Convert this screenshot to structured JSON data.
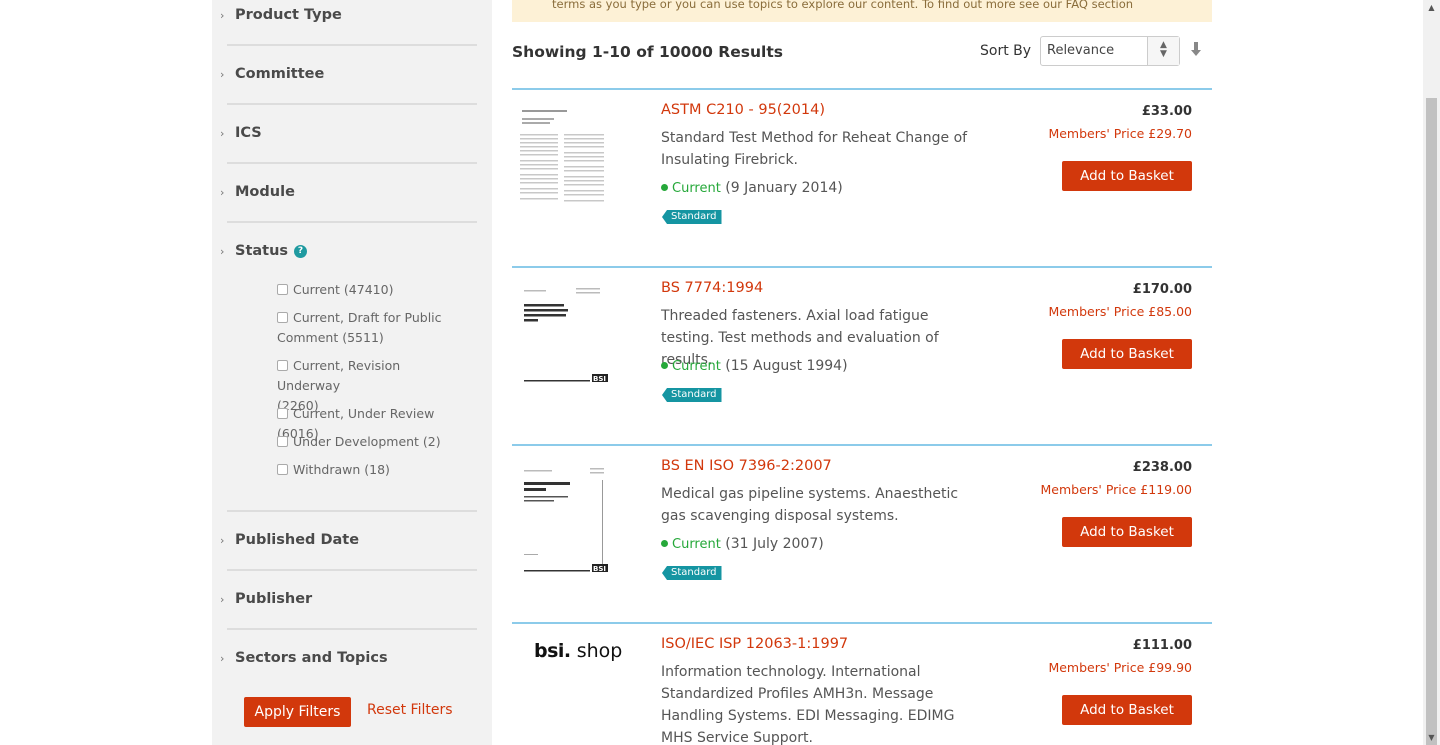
{
  "banner": {
    "text": "terms as you type or you can use topics to explore our content. To find out more see our FAQ section"
  },
  "sidebar": {
    "facets": {
      "product_type": "Product Type",
      "committee": "Committee",
      "ics": "ICS",
      "module": "Module",
      "status": "Status",
      "published_date": "Published Date",
      "publisher": "Publisher",
      "sectors": "Sectors and Topics"
    },
    "status_options": [
      {
        "line1": "Current (47410)",
        "line2": ""
      },
      {
        "line1": "Current, Draft for Public",
        "line2": "Comment (5511)"
      },
      {
        "line1": "Current, Revision Underway",
        "line2": "(2260)"
      },
      {
        "line1": "Current, Under Review (6016)",
        "line2": ""
      },
      {
        "line1": "Under Development (2)",
        "line2": ""
      },
      {
        "line1": "Withdrawn (18)",
        "line2": ""
      }
    ],
    "help_symbol": "?",
    "apply_label": "Apply Filters",
    "reset_label": "Reset Filters"
  },
  "toolbar": {
    "summary": "Showing 1-10 of 10000 Results",
    "sort_label": "Sort By",
    "sort_value": "Relevance"
  },
  "results": [
    {
      "title": "ASTM C210 - 95(2014)",
      "desc": "Standard Test Method for Reheat Change of Insulating Firebrick.",
      "status": "Current",
      "date": "(9 January 2014)",
      "badge": "Standard",
      "price": "£33.00",
      "member_price": "Members' Price £29.70",
      "button": "Add to Basket"
    },
    {
      "title": "BS 7774:1994",
      "desc": "Threaded fasteners. Axial load fatigue testing. Test methods and evaluation of results.",
      "status": "Current",
      "date": "(15 August 1994)",
      "badge": "Standard",
      "price": "£170.00",
      "member_price": "Members' Price £85.00",
      "button": "Add to Basket"
    },
    {
      "title": "BS EN ISO 7396-2:2007",
      "desc": "Medical gas pipeline systems. Anaesthetic gas scavenging disposal systems.",
      "status": "Current",
      "date": "(31 July 2007)",
      "badge": "Standard",
      "price": "£238.00",
      "member_price": "Members' Price £119.00",
      "button": "Add to Basket"
    },
    {
      "title": "ISO/IEC ISP 12063-1:1997",
      "desc": "Information technology. International Standardized Profiles AMH3n. Message Handling Systems. EDI Messaging. EDIMG MHS Service Support.",
      "logo_brand": "bsi.",
      "logo_shop": "shop",
      "price": "£111.00",
      "member_price": "Members' Price £99.90",
      "button": "Add to Basket"
    }
  ],
  "colors": {
    "accent": "#d2380c",
    "teal": "#1595a2",
    "current": "#26a83a",
    "divider_blue": "#8ccbea"
  }
}
